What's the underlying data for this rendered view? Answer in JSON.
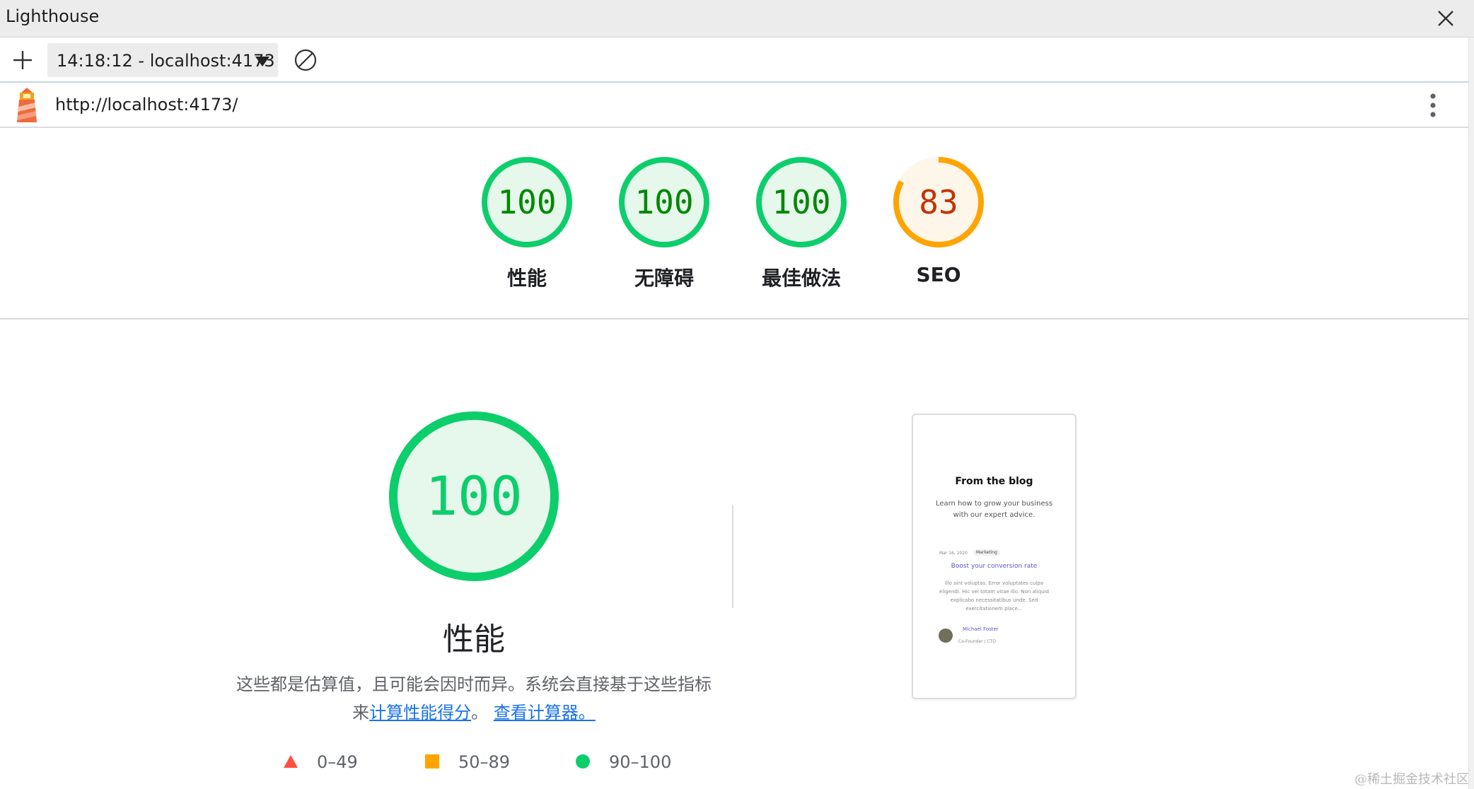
{
  "window": {
    "title": "Lighthouse"
  },
  "toolbar": {
    "report_select": "14:18:12 - localhost:4173"
  },
  "urlbar": {
    "url": "http://localhost:4173/"
  },
  "summary": [
    {
      "score": "100",
      "label": "性能",
      "status": "pass"
    },
    {
      "score": "100",
      "label": "无障碍",
      "status": "pass"
    },
    {
      "score": "100",
      "label": "最佳做法",
      "status": "pass"
    },
    {
      "score": "83",
      "label": "SEO",
      "status": "average"
    }
  ],
  "performance": {
    "score": "100",
    "title": "性能",
    "description_prefix": "这些都是估算值，且可能会因时而异。系统会直接基于这些指标来",
    "link_calc": "计算性能得分",
    "sep": "。",
    "link_calculator": "查看计算器。"
  },
  "legend": [
    {
      "range": "0–49",
      "shape": "triangle",
      "color": "#ff4e42"
    },
    {
      "range": "50–89",
      "shape": "square",
      "color": "#ffa400"
    },
    {
      "range": "90–100",
      "shape": "circle",
      "color": "#0cce6b"
    }
  ],
  "screenshot": {
    "title": "From the blog",
    "subtitle": "Learn how to grow your business with our expert advice.",
    "date": "Mar 16, 2020",
    "tag": "Marketing",
    "post_title": "Boost your conversion rate",
    "post_body": "Illo sint voluptas. Error voluptates culpa eligendi. Hic vel totam vitae illo. Non aliquid explicabo necessitatibus unde. Sed exercitationem place...",
    "author": "Michael Foster",
    "role": "Co-Founder / CTO"
  },
  "colors": {
    "pass": "#0cce6b",
    "pass_text": "#008800",
    "pass_fill": "#e6f7ec",
    "average": "#ffa400",
    "average_text": "#c33300",
    "average_fill": "#fff6ea",
    "link": "#1a73e8"
  },
  "watermark": "@稀土掘金技术社区"
}
